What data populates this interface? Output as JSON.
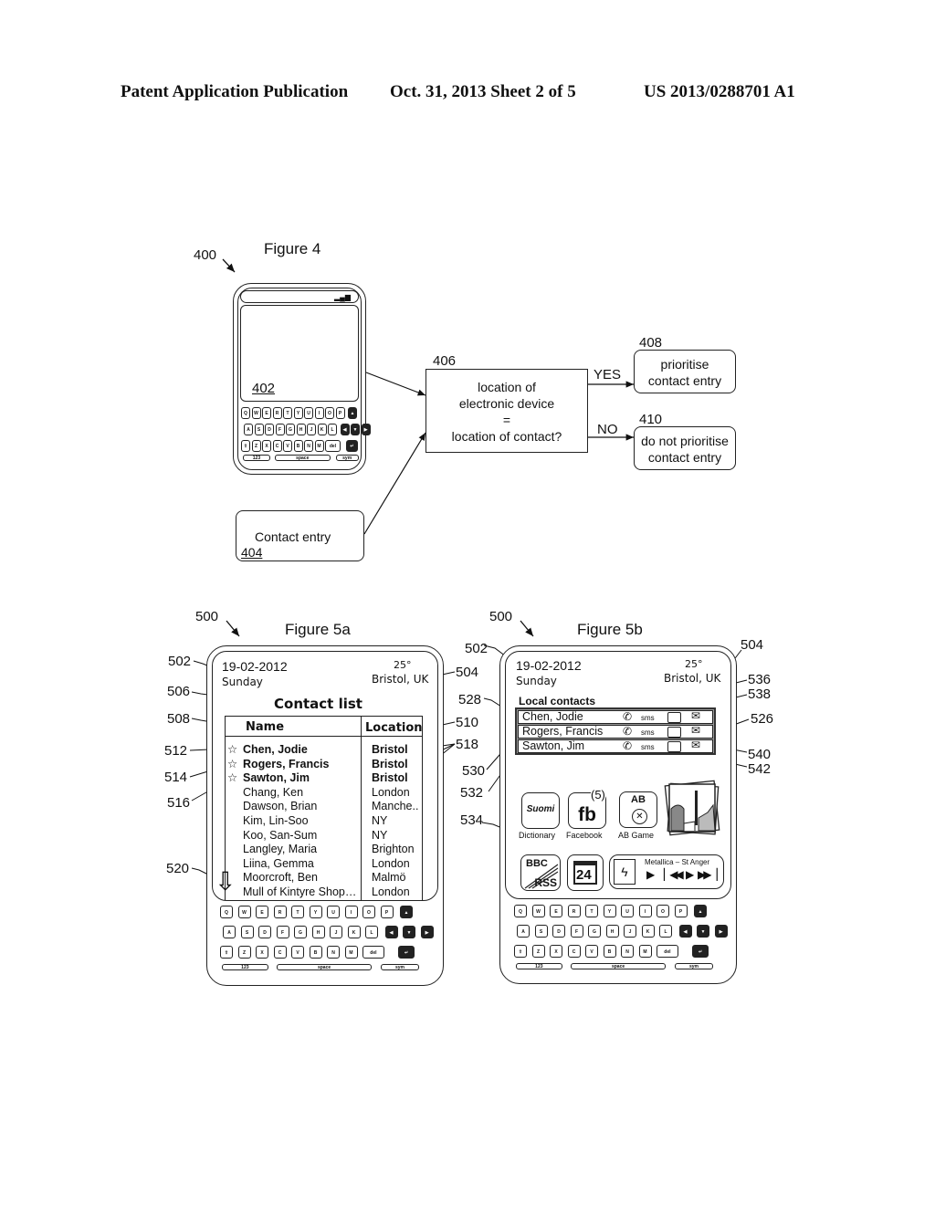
{
  "header": {
    "publication": "Patent Application Publication",
    "date_sheet": "Oct. 31, 2013   Sheet 2 of 5",
    "number": "US 2013/0288701 A1"
  },
  "figure4": {
    "title": "Figure 4",
    "ref_device": "400",
    "ref_screen": "402",
    "contact_box": {
      "label": "Contact entry",
      "ref": "404"
    },
    "decision_box": {
      "ref": "406",
      "lines": [
        "location of",
        "electronic device",
        "=",
        "location of contact?"
      ]
    },
    "yes_label": "YES",
    "no_label": "NO",
    "yes_box": {
      "ref": "408",
      "lines": [
        "prioritise",
        "contact entry"
      ]
    },
    "no_box": {
      "ref": "410",
      "lines": [
        "do not prioritise",
        "contact entry"
      ]
    }
  },
  "keyboard": {
    "row1": [
      "Q",
      "W",
      "E",
      "R",
      "T",
      "Y",
      "U",
      "I",
      "O",
      "P"
    ],
    "row2": [
      "A",
      "S",
      "D",
      "F",
      "G",
      "H",
      "J",
      "K",
      "L"
    ],
    "row3": [
      "Z",
      "X",
      "C",
      "V",
      "B",
      "N",
      "M"
    ],
    "del": "del",
    "key_123": "123",
    "space": "space",
    "sym": "sym"
  },
  "figure5a": {
    "title": "Figure 5a",
    "ref_device": "500",
    "date": "19-02-2012",
    "day": "Sunday",
    "temperature": "25°",
    "location": "Bristol, UK",
    "list_title": "Contact list",
    "col_name": "Name",
    "col_location": "Location",
    "contacts": [
      {
        "name": "Chen, Jodie",
        "location": "Bristol",
        "priority": true
      },
      {
        "name": "Rogers, Francis",
        "location": "Bristol",
        "priority": true
      },
      {
        "name": "Sawton, Jim",
        "location": "Bristol",
        "priority": true
      },
      {
        "name": "Chang, Ken",
        "location": "London",
        "priority": false
      },
      {
        "name": "Dawson, Brian",
        "location": "Manche..",
        "priority": false
      },
      {
        "name": "Kim, Lin-Soo",
        "location": "NY",
        "priority": false
      },
      {
        "name": "Koo, San-Sum",
        "location": "NY",
        "priority": false
      },
      {
        "name": "Langley, Maria",
        "location": "Brighton",
        "priority": false
      },
      {
        "name": "Liina, Gemma",
        "location": "London",
        "priority": false
      },
      {
        "name": "Moorcroft, Ben",
        "location": "Malmö",
        "priority": false
      },
      {
        "name": "Mull of Kintyre Shop…",
        "location": "London",
        "priority": false
      }
    ],
    "refs": {
      "r502": "502",
      "r504": "504",
      "r506": "506",
      "r508": "508",
      "r510": "510",
      "r512": "512",
      "r514": "514",
      "r516": "516",
      "r518": "518",
      "r520": "520"
    }
  },
  "figure5b": {
    "title": "Figure 5b",
    "ref_device": "500",
    "date": "19-02-2012",
    "day": "Sunday",
    "temperature": "25°",
    "location": "Bristol, UK",
    "section_title": "Local contacts",
    "sms_label": "sms",
    "local_contacts": [
      "Chen, Jodie",
      "Rogers, Francis",
      "Sawton, Jim"
    ],
    "apps": {
      "dictionary_icon": "Suomi",
      "dictionary_label": "Dictionary",
      "facebook_icon": "fb",
      "facebook_badge": "(5)",
      "facebook_label": "Facebook",
      "game_icon": "AB",
      "game_label": "AB Game",
      "rss_top": "BBC",
      "rss_bottom": "RSS",
      "calendar_day": "24",
      "music_track": "Metallica – St Anger"
    },
    "refs": {
      "r502": "502",
      "r504": "504",
      "r526": "526",
      "r528": "528",
      "r530": "530",
      "r532": "532",
      "r534": "534",
      "r536": "536",
      "r538": "538",
      "r540": "540",
      "r542": "542"
    }
  }
}
